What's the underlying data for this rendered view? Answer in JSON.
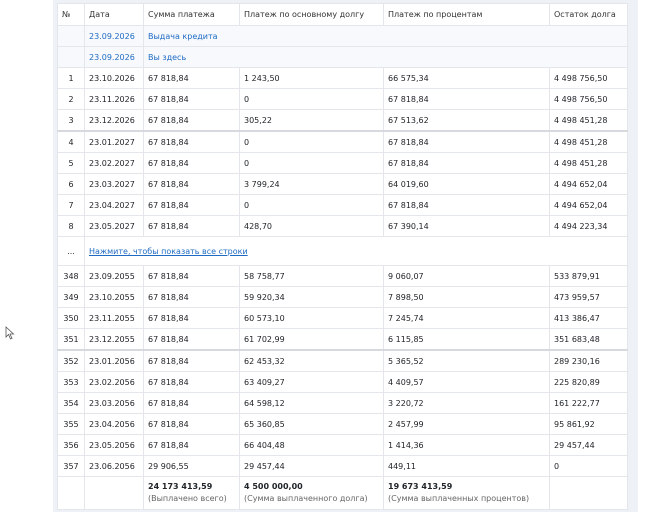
{
  "columns": [
    "№",
    "Дата",
    "Сумма платежа",
    "Платеж по основному долгу",
    "Платеж по процентам",
    "Остаток долга"
  ],
  "info_rows": [
    {
      "date": "23.09.2026",
      "label": "Выдача кредита"
    },
    {
      "date": "23.09.2026",
      "label": "Вы здесь"
    }
  ],
  "rows_top": [
    {
      "n": "1",
      "date": "23.10.2026",
      "payment": "67 818,84",
      "principal": "1 243,50",
      "interest": "66 575,34",
      "balance": "4 498 756,50"
    },
    {
      "n": "2",
      "date": "23.11.2026",
      "payment": "67 818,84",
      "principal": "0",
      "interest": "67 818,84",
      "balance": "4 498 756,50"
    },
    {
      "n": "3",
      "date": "23.12.2026",
      "payment": "67 818,84",
      "principal": "305,22",
      "interest": "67 513,62",
      "balance": "4 498 451,28"
    },
    {
      "n": "4",
      "date": "23.01.2027",
      "payment": "67 818,84",
      "principal": "0",
      "interest": "67 818,84",
      "balance": "4 498 451,28"
    },
    {
      "n": "5",
      "date": "23.02.2027",
      "payment": "67 818,84",
      "principal": "0",
      "interest": "67 818,84",
      "balance": "4 498 451,28"
    },
    {
      "n": "6",
      "date": "23.03.2027",
      "payment": "67 818,84",
      "principal": "3 799,24",
      "interest": "64 019,60",
      "balance": "4 494 652,04"
    },
    {
      "n": "7",
      "date": "23.04.2027",
      "payment": "67 818,84",
      "principal": "0",
      "interest": "67 818,84",
      "balance": "4 494 652,04"
    },
    {
      "n": "8",
      "date": "23.05.2027",
      "payment": "67 818,84",
      "principal": "428,70",
      "interest": "67 390,14",
      "balance": "4 494 223,34"
    }
  ],
  "expand": {
    "dots": "...",
    "link": "Нажмите, чтобы показать все строки"
  },
  "rows_bottom": [
    {
      "n": "348",
      "date": "23.09.2055",
      "payment": "67 818,84",
      "principal": "58 758,77",
      "interest": "9 060,07",
      "balance": "533 879,91"
    },
    {
      "n": "349",
      "date": "23.10.2055",
      "payment": "67 818,84",
      "principal": "59 920,34",
      "interest": "7 898,50",
      "balance": "473 959,57"
    },
    {
      "n": "350",
      "date": "23.11.2055",
      "payment": "67 818,84",
      "principal": "60 573,10",
      "interest": "7 245,74",
      "balance": "413 386,47"
    },
    {
      "n": "351",
      "date": "23.12.2055",
      "payment": "67 818,84",
      "principal": "61 702,99",
      "interest": "6 115,85",
      "balance": "351 683,48"
    },
    {
      "n": "352",
      "date": "23.01.2056",
      "payment": "67 818,84",
      "principal": "62 453,32",
      "interest": "5 365,52",
      "balance": "289 230,16"
    },
    {
      "n": "353",
      "date": "23.02.2056",
      "payment": "67 818,84",
      "principal": "63 409,27",
      "interest": "4 409,57",
      "balance": "225 820,89"
    },
    {
      "n": "354",
      "date": "23.03.2056",
      "payment": "67 818,84",
      "principal": "64 598,12",
      "interest": "3 220,72",
      "balance": "161 222,77"
    },
    {
      "n": "355",
      "date": "23.04.2056",
      "payment": "67 818,84",
      "principal": "65 360,85",
      "interest": "2 457,99",
      "balance": "95 861,92"
    },
    {
      "n": "356",
      "date": "23.05.2056",
      "payment": "67 818,84",
      "principal": "66 404,48",
      "interest": "1 414,36",
      "balance": "29 457,44"
    },
    {
      "n": "357",
      "date": "23.06.2056",
      "payment": "29 906,55",
      "principal": "29 457,44",
      "interest": "449,11",
      "balance": "0"
    }
  ],
  "totals": {
    "paid_total": "24 173 413,59",
    "paid_total_caption": "(Выплачено всего)",
    "principal_total": "4 500 000,00",
    "principal_total_caption": "(Сумма выплаченного долга)",
    "interest_total": "19 673 413,59",
    "interest_total_caption": "(Сумма выплаченных процентов)"
  }
}
